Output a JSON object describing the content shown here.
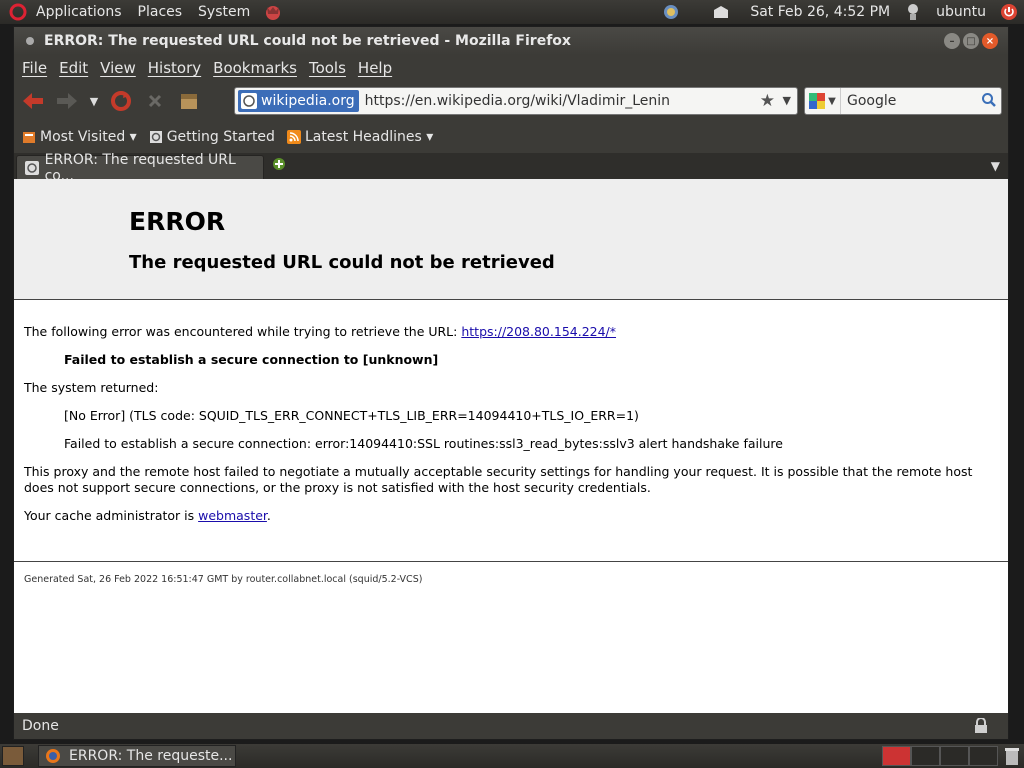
{
  "top_panel": {
    "menus": [
      "Applications",
      "Places",
      "System"
    ],
    "clock": "Sat Feb 26,  4:52 PM",
    "user": "ubuntu"
  },
  "window": {
    "title": "ERROR: The requested URL could not be retrieved - Mozilla Firefox"
  },
  "menubar": [
    "File",
    "Edit",
    "View",
    "History",
    "Bookmarks",
    "Tools",
    "Help"
  ],
  "navbar": {
    "site_identity": "wikipedia.org",
    "url": "https://en.wikipedia.org/wiki/Vladimir_Lenin",
    "search_value": "Google"
  },
  "bookmarks": [
    {
      "label": "Most Visited ▾",
      "icon": "most-visited-icon"
    },
    {
      "label": "Getting Started",
      "icon": "getting-started-icon"
    },
    {
      "label": "Latest Headlines ▾",
      "icon": "rss-feed-icon"
    }
  ],
  "tab": {
    "label": "ERROR: The requested URL co..."
  },
  "page": {
    "heading": "ERROR",
    "subheading": "The requested URL could not be retrieved",
    "intro": "The following error was encountered while trying to retrieve the URL: ",
    "url_link": "https://208.80.154.224/*",
    "failed_msg": "Failed to establish a secure connection to [unknown]",
    "system_returned": "The system returned:",
    "no_error": "[No Error] (TLS code: SQUID_TLS_ERR_CONNECT+TLS_LIB_ERR=14094410+TLS_IO_ERR=1)",
    "ssl_error": "Failed to establish a secure connection: error:14094410:SSL routines:ssl3_read_bytes:sslv3 alert handshake failure",
    "proxy_msg": "This proxy and the remote host failed to negotiate a mutually acceptable security settings for handling your request. It is possible that the remote host does not support secure connections, or the proxy is not satisfied with the host security credentials.",
    "admin_prefix": "Your cache administrator is ",
    "admin_link": "webmaster",
    "admin_suffix": ".",
    "generated": "Generated Sat, 26 Feb 2022 16:51:47 GMT by router.collabnet.local (squid/5.2-VCS)"
  },
  "status": "Done",
  "taskbar": {
    "task_label": "ERROR: The requeste..."
  },
  "colors": {
    "panel": "#3c3b37",
    "link": "#1a0dab",
    "site_identity_bg": "#3c6db8"
  }
}
